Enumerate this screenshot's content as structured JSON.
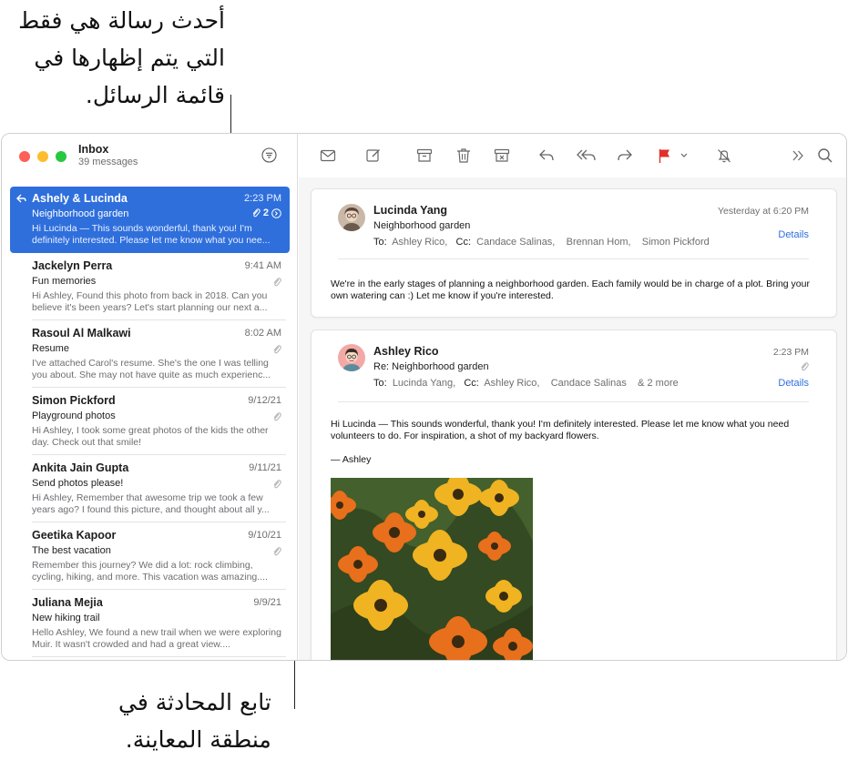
{
  "callouts": {
    "top": [
      "أحدث رسالة هي فقط",
      "التي يتم إظهارها في",
      "قائمة الرسائل."
    ],
    "bottom": [
      "تابع المحادثة في",
      "منطقة المعاينة."
    ]
  },
  "sidebar": {
    "title": "Inbox",
    "count": "39 messages",
    "messages": [
      {
        "sender": "Ashely & Lucinda",
        "time": "2:23 PM",
        "subject": "Neighborhood garden",
        "thread_count": "2",
        "preview": "Hi Lucinda — This sounds wonderful, thank you! I'm definitely interested. Please let me know what you nee..."
      },
      {
        "sender": "Jackelyn Perra",
        "time": "9:41 AM",
        "subject": "Fun memories",
        "preview": "Hi Ashley, Found this photo from back in 2018. Can you believe it's been years? Let's start planning our next a..."
      },
      {
        "sender": "Rasoul Al Malkawi",
        "time": "8:02 AM",
        "subject": "Resume",
        "preview": "I've attached Carol's resume. She's the one I was telling you about. She may not have quite as much experienc..."
      },
      {
        "sender": "Simon Pickford",
        "time": "9/12/21",
        "subject": "Playground photos",
        "preview": "Hi Ashley, I took some great photos of the kids the other day. Check out that smile!"
      },
      {
        "sender": "Ankita Jain Gupta",
        "time": "9/11/21",
        "subject": "Send photos please!",
        "preview": "Hi Ashley, Remember that awesome trip we took a few years ago? I found this picture, and thought about all y..."
      },
      {
        "sender": "Geetika Kapoor",
        "time": "9/10/21",
        "subject": "The best vacation",
        "preview": "Remember this journey? We did a lot: rock climbing, cycling, hiking, and more. This vacation was amazing...."
      },
      {
        "sender": "Juliana Mejia",
        "time": "9/9/21",
        "subject": "New hiking trail",
        "preview": "Hello Ashley, We found a new trail when we were exploring Muir. It wasn't crowded and had a great view...."
      }
    ]
  },
  "toolbar": {
    "icons": [
      "envelope-icon",
      "compose-icon",
      "archive-icon",
      "trash-icon",
      "junk-icon",
      "reply-icon",
      "reply-all-icon",
      "forward-icon",
      "flag-icon",
      "flag-menu-chevron-icon",
      "mute-icon",
      "more-icon",
      "search-icon"
    ],
    "flag_color": "#e0302b"
  },
  "thread": [
    {
      "name": "Lucinda Yang",
      "time": "Yesterday at 6:20 PM",
      "subject": "Neighborhood garden",
      "to_label": "To:",
      "to": "Ashley Rico,",
      "cc_label": "Cc:",
      "cc": [
        "Candace Salinas,",
        "Brennan Hom,",
        "Simon Pickford"
      ],
      "details": "Details",
      "body": "We're in the early stages of planning a neighborhood garden. Each family would be in charge of a plot. Bring your own watering can :) Let me know if you're interested."
    },
    {
      "name": "Ashley Rico",
      "time": "2:23 PM",
      "subject": "Re: Neighborhood garden",
      "to_label": "To:",
      "to": "Lucinda Yang,",
      "cc_label": "Cc:",
      "cc": [
        "Ashley Rico,",
        "Candace Salinas",
        "& 2 more"
      ],
      "details": "Details",
      "body": "Hi Lucinda — This sounds wonderful, thank you! I'm definitely interested. Please let me know what you need volunteers to do. For inspiration, a shot of my backyard flowers.",
      "signature": "— Ashley"
    }
  ],
  "colors": {
    "accent": "#2f6fdc",
    "selected_bg": "#2f6fdc"
  }
}
